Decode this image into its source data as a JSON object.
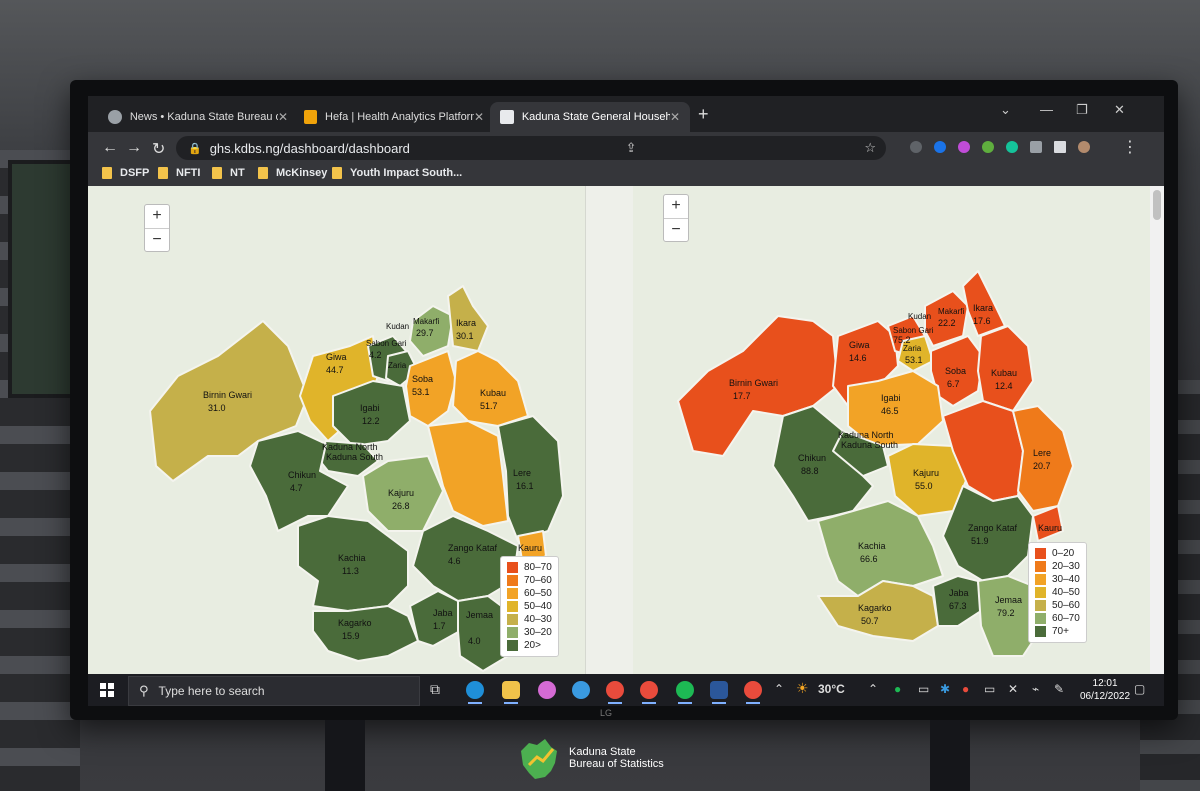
{
  "browser": {
    "tabs": [
      {
        "label": "News • Kaduna State Bureau of S",
        "icon": "globe-icon"
      },
      {
        "label": "Hefa | Health Analytics Platform",
        "icon": "hefa-logo-icon"
      },
      {
        "label": "Kaduna State General Household",
        "icon": "a-logo-icon",
        "active": true
      }
    ],
    "url": "ghs.kdbs.ng/dashboard/dashboard",
    "bookmarks": [
      "DSFP",
      "NFTI",
      "NT",
      "McKinsey",
      "Youth Impact South..."
    ]
  },
  "colors": {
    "dark_green": "#4a6b3a",
    "light_green": "#8fae6a",
    "olive": "#c5b04a",
    "yellow": "#e0b42a",
    "orange": "#f2a326",
    "dark_orange": "#ef7a1a",
    "red_orange": "#e8501c"
  },
  "map_left": {
    "regions": [
      {
        "name": "Birnin Gwari",
        "value": "31.0"
      },
      {
        "name": "Giwa",
        "value": "44.7"
      },
      {
        "name": "Sabon Gari",
        "value": "4.2"
      },
      {
        "name": "Kudan",
        "value": ""
      },
      {
        "name": "Makarfi",
        "value": "29.7"
      },
      {
        "name": "Ikara",
        "value": "30.1"
      },
      {
        "name": "Soba",
        "value": "53.1"
      },
      {
        "name": "Kubau",
        "value": "51.7"
      },
      {
        "name": "Igabi",
        "value": "12.2"
      },
      {
        "name": "Kaduna North",
        "value": ""
      },
      {
        "name": "Kaduna South",
        "value": ""
      },
      {
        "name": "Chikun",
        "value": "4.7"
      },
      {
        "name": "Kajuru",
        "value": "26.8"
      },
      {
        "name": "Lere",
        "value": "16.1"
      },
      {
        "name": "Kachia",
        "value": "11.3"
      },
      {
        "name": "Zango Kataf",
        "value": "4.6"
      },
      {
        "name": "Kauru",
        "value": ""
      },
      {
        "name": "Kagarko",
        "value": "15.9"
      },
      {
        "name": "Jaba",
        "value": "1.7"
      },
      {
        "name": "Jemaa",
        "value": "4.0"
      },
      {
        "name": "Zaria",
        "value": ""
      }
    ],
    "legend": [
      "80–70",
      "70–60",
      "60–50",
      "50–40",
      "40–30",
      "30–20",
      "20>"
    ]
  },
  "map_right": {
    "regions": [
      {
        "name": "Birnin Gwari",
        "value": "17.7"
      },
      {
        "name": "Giwa",
        "value": "14.6"
      },
      {
        "name": "Sabon Gari",
        "value": "75.2"
      },
      {
        "name": "Kudan",
        "value": ""
      },
      {
        "name": "Makarfi",
        "value": "22.2"
      },
      {
        "name": "Ikara",
        "value": "17.6"
      },
      {
        "name": "Zaria",
        "value": "53.1"
      },
      {
        "name": "Soba",
        "value": "6.7"
      },
      {
        "name": "Kubau",
        "value": "12.4"
      },
      {
        "name": "Igabi",
        "value": "46.5"
      },
      {
        "name": "Kaduna North",
        "value": ""
      },
      {
        "name": "Kaduna South",
        "value": ""
      },
      {
        "name": "Chikun",
        "value": "88.8"
      },
      {
        "name": "Kajuru",
        "value": "55.0"
      },
      {
        "name": "Lere",
        "value": "20.7"
      },
      {
        "name": "Kachia",
        "value": "66.6"
      },
      {
        "name": "Zango Kataf",
        "value": "51.9"
      },
      {
        "name": "Kauru",
        "value": ""
      },
      {
        "name": "Kagarko",
        "value": "50.7"
      },
      {
        "name": "Jaba",
        "value": "67.3"
      },
      {
        "name": "Jemaa",
        "value": "79.2"
      }
    ],
    "legend": [
      "0–20",
      "20–30",
      "30–40",
      "40–50",
      "50–60",
      "60–70",
      "70+"
    ]
  },
  "taskbar": {
    "search_placeholder": "Type here to search",
    "temperature": "30°C",
    "time": "12:01",
    "date": "06/12/2022"
  },
  "brand": {
    "line1": "Kaduna State",
    "line2": "Bureau of Statistics"
  },
  "monitor": {
    "logo": "LG"
  }
}
